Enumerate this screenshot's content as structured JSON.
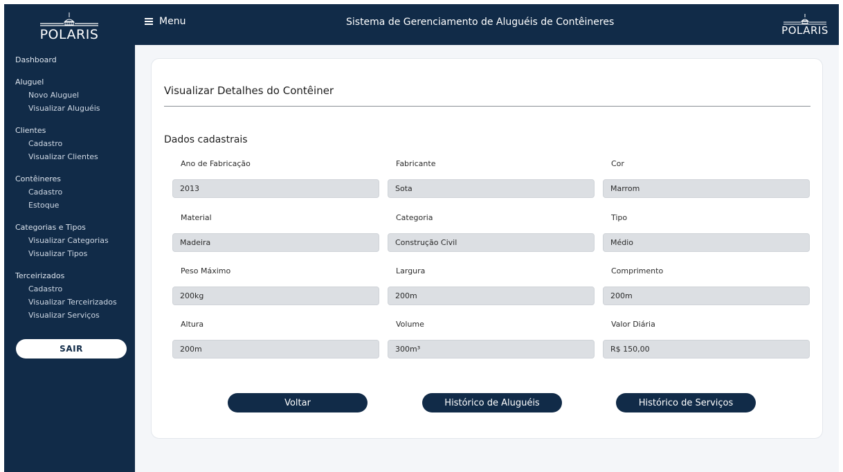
{
  "brand": {
    "logo_text": "POLARIS"
  },
  "colors": {
    "navy": "#112b48",
    "background": "#f4f6f9",
    "input_bg": "#dcdfe3",
    "white": "#ffffff"
  },
  "topbar": {
    "menu_label": "Menu",
    "menu_icon": "hamburger-icon",
    "title": "Sistema de Gerenciamento de Aluguéis de Contêineres"
  },
  "sidebar": {
    "groups": [
      {
        "title": "Dashboard",
        "items": []
      },
      {
        "title": "Aluguel",
        "items": [
          "Novo Aluguel",
          "Visualizar Aluguéis"
        ]
      },
      {
        "title": "Clientes",
        "items": [
          "Cadastro",
          "Visualizar Clientes"
        ]
      },
      {
        "title": "Contêineres",
        "items": [
          "Cadastro",
          "Estoque"
        ]
      },
      {
        "title": "Categorias e Tipos",
        "items": [
          "Visualizar Categorias",
          "Visualizar Tipos"
        ]
      },
      {
        "title": "Terceirizados",
        "items": [
          "Cadastro",
          "Visualizar Terceirizados",
          "Visualizar Serviços"
        ]
      }
    ],
    "logout_label": "SAIR"
  },
  "main": {
    "page_title": "Visualizar Detalhes do Contêiner",
    "section_title": "Dados cadastrais",
    "fields": [
      {
        "label": "Ano de Fabricação",
        "value": "2013"
      },
      {
        "label": "Fabricante",
        "value": "Sota"
      },
      {
        "label": "Cor",
        "value": "Marrom"
      },
      {
        "label": "Material",
        "value": "Madeira"
      },
      {
        "label": "Categoria",
        "value": "Construção Civil"
      },
      {
        "label": "Tipo",
        "value": "Médio"
      },
      {
        "label": "Peso Máximo",
        "value": "200kg"
      },
      {
        "label": "Largura",
        "value": "200m"
      },
      {
        "label": "Comprimento",
        "value": "200m"
      },
      {
        "label": "Altura",
        "value": "200m"
      },
      {
        "label": "Volume",
        "value": "300m³"
      },
      {
        "label": "Valor Diária",
        "value": "R$ 150,00"
      }
    ],
    "buttons": {
      "back": "Voltar",
      "rental_history": "Histórico de Aluguéis",
      "service_history": "Histórico de Serviços"
    }
  }
}
